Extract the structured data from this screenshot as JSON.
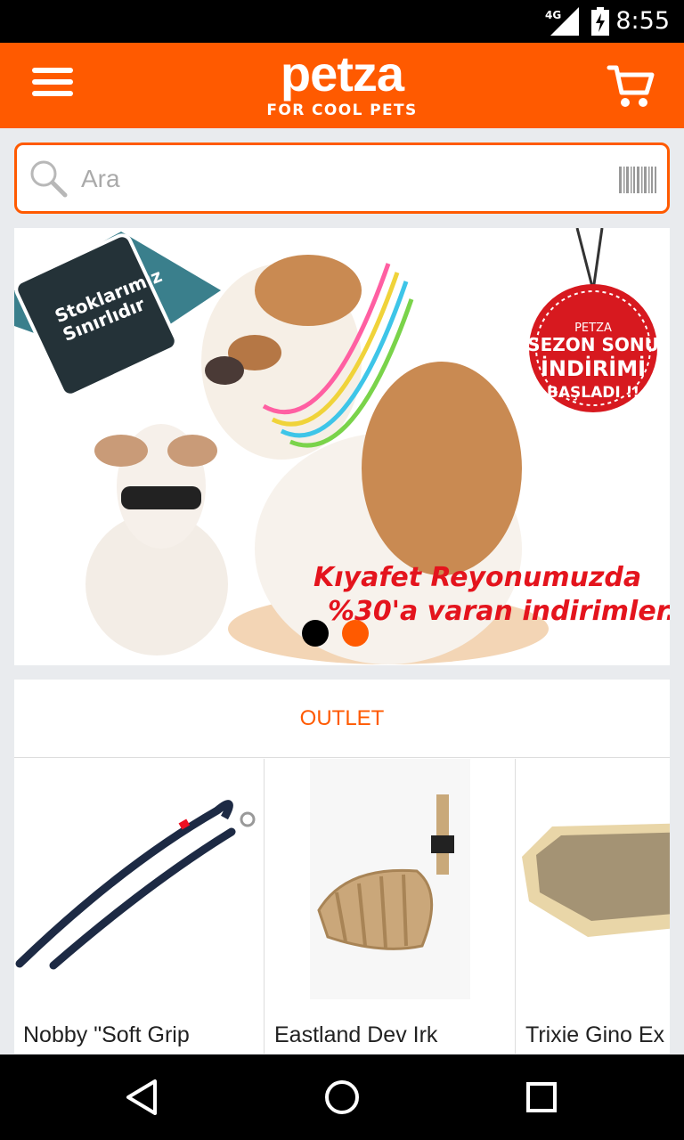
{
  "status_bar": {
    "network": "4G",
    "time": "8:55"
  },
  "header": {
    "brand": "petza",
    "tagline": "FOR COOL PETS"
  },
  "search": {
    "placeholder": "Ara"
  },
  "banner": {
    "badge_left_line1": "Stoklarımız",
    "badge_left_line2": "Sınırlıdır",
    "tag_line1": "PETZA",
    "tag_line2": "SEZON SONU",
    "tag_line3": "İNDİRİMİ",
    "tag_line4": "BAŞLADI !!",
    "promo_line1": "Kıyafet Reyonumuzda",
    "promo_line2": "%30'a varan indirimler..",
    "slide_count": 2,
    "active_slide": 2
  },
  "outlet": {
    "title": "OUTLET",
    "products": [
      {
        "title": "Nobby \"Soft Grip"
      },
      {
        "title": "Eastland Dev Irk"
      },
      {
        "title": "Trixie Gino Ex"
      }
    ]
  },
  "colors": {
    "accent": "#ff5a00",
    "background": "#e9ebee"
  }
}
